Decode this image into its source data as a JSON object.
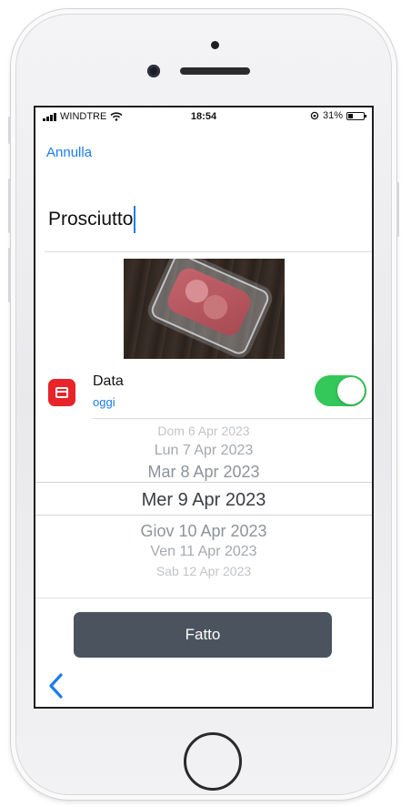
{
  "status_bar": {
    "carrier": "WINDTRE",
    "time": "18:54",
    "battery": "31%",
    "battery_level": 0.31
  },
  "nav": {
    "cancel_label": "Annulla"
  },
  "item": {
    "title": "Prosciutto"
  },
  "date_row": {
    "label": "Data",
    "sublabel": "oggi",
    "toggle_on": true
  },
  "picker": {
    "items": [
      "Dom 6 Apr 2023",
      "Lun 7 Apr 2023",
      "Mar 8 Apr 2023",
      "Mer 9 Apr 2023",
      "Giov 10 Apr 2023",
      "Ven 11 Apr 2023",
      "Sab 12 Apr 2023"
    ],
    "selected_index": 3
  },
  "footer": {
    "done_label": "Fatto"
  },
  "colors": {
    "accent": "#1a7cf0",
    "toggle_on": "#34c759",
    "button": "#4b535f",
    "calendar_icon": "#e8232a"
  },
  "icons": {
    "signal": "signal-bars-icon",
    "wifi": "wifi-icon",
    "orientation_lock": "orientation-lock-icon",
    "battery": "battery-icon",
    "calendar": "calendar-icon",
    "back": "chevron-left-icon"
  }
}
